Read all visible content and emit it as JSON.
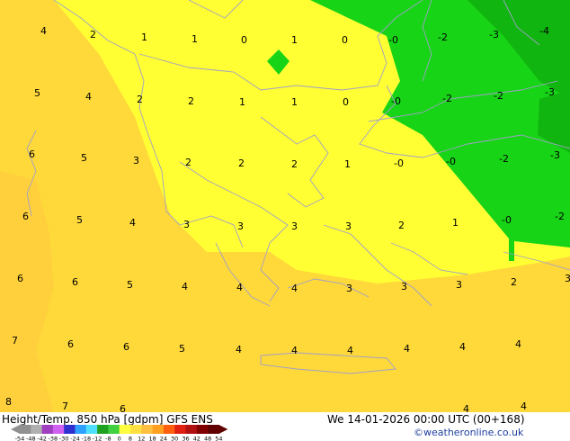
{
  "map": {
    "labels": [
      "4",
      "2",
      "1",
      "1",
      "0",
      "1",
      "0",
      "-0",
      "-2",
      "-3",
      "-4",
      "5",
      "4",
      "2",
      "2",
      "1",
      "1",
      "0",
      "-0",
      "-2",
      "-2",
      "-3",
      "6",
      "5",
      "3",
      "2",
      "2",
      "2",
      "1",
      "-0",
      "-0",
      "-2",
      "-3",
      "6",
      "5",
      "4",
      "3",
      "3",
      "3",
      "3",
      "2",
      "1",
      "-0",
      "-2",
      "6",
      "6",
      "5",
      "4",
      "4",
      "4",
      "3",
      "3",
      "3",
      "2",
      "3",
      "7",
      "6",
      "6",
      "5",
      "4",
      "4",
      "4",
      "4",
      "4",
      "4",
      "8",
      "7",
      "6",
      "4",
      "4"
    ]
  },
  "footer": {
    "title": "Height/Temp. 850 hPa [gdpm] GFS ENS",
    "valid_time": "We 14-01-2026 00:00 UTC (00+168)",
    "credit": "©weatheronline.co.uk"
  },
  "scale": {
    "ticks": [
      "-54",
      "-48",
      "-42",
      "-38",
      "-30",
      "-24",
      "-18",
      "-12",
      "-8",
      "0",
      "8",
      "12",
      "18",
      "24",
      "30",
      "36",
      "42",
      "48",
      "54"
    ],
    "colors": [
      "#909090",
      "#b0b0b0",
      "#a040c0",
      "#d060f0",
      "#3030d0",
      "#30a0ff",
      "#50e0ff",
      "#20a020",
      "#40d040",
      "#ffff40",
      "#ffe040",
      "#ffc040",
      "#ffa020",
      "#ff6010",
      "#e02010",
      "#b01010",
      "#800000",
      "#600000"
    ]
  }
}
